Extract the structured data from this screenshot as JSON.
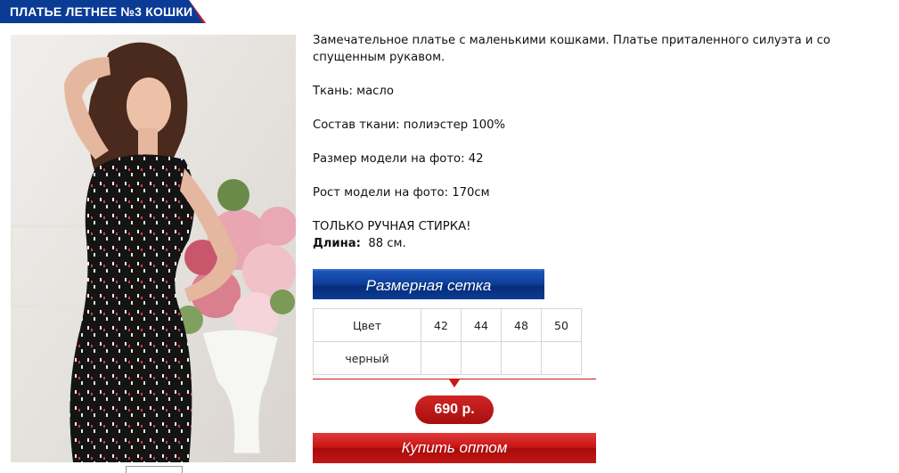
{
  "product": {
    "title": "ПЛАТЬЕ ЛЕТНЕЕ №3 КОШКИ",
    "image_alt_icon": "product-photo"
  },
  "description": {
    "intro": "Замечательное платье с маленькими кошками. Платье приталенного силуэта и со спущенным рукавом.",
    "fabric": "Ткань: масло",
    "composition": "Состав ткани: полиэстер 100%",
    "model_size": "Размер модели на фото: 42",
    "model_height": "Рост модели на фото: 170см",
    "care": "ТОЛЬКО РУЧНАЯ СТИРКА!",
    "length_label": "Длина:",
    "length_value": "88 см."
  },
  "size_chart_button": "Размерная сетка",
  "size_table": {
    "header": [
      "Цвет",
      "42",
      "44",
      "48",
      "50"
    ],
    "rows": [
      [
        "черный",
        "",
        "",
        "",
        ""
      ]
    ]
  },
  "price": "690 р.",
  "buy_button": "Купить оптом",
  "colors": {
    "brand_blue": "#0a3c96",
    "accent_red": "#c81818"
  }
}
